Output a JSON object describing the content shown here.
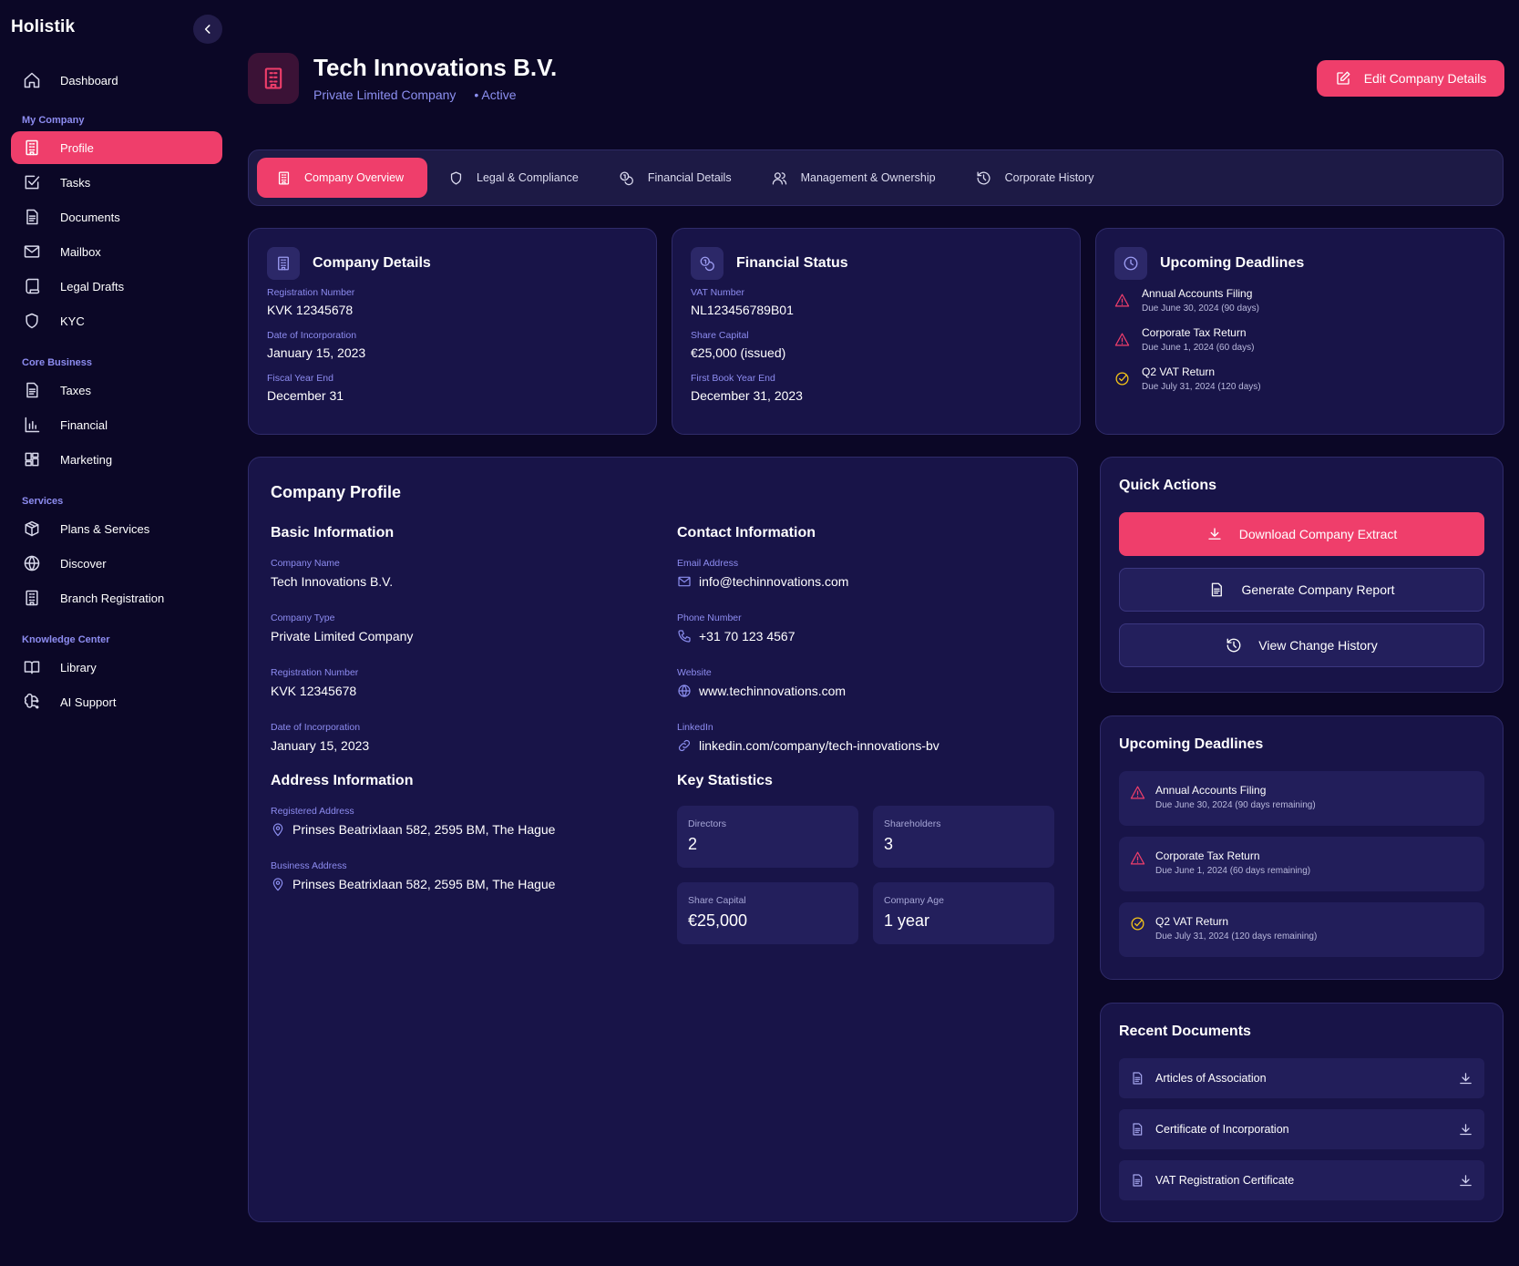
{
  "sidebar": {
    "brand": "Holistik",
    "sections": [
      {
        "title": "",
        "items": [
          {
            "label": "Dashboard",
            "icon": "home-icon"
          }
        ]
      },
      {
        "title": "My Company",
        "items": [
          {
            "label": "Profile",
            "icon": "building-icon",
            "active": true
          },
          {
            "label": "Tasks",
            "icon": "checkbox-icon"
          },
          {
            "label": "Documents",
            "icon": "document-icon"
          },
          {
            "label": "Mailbox",
            "icon": "mail-icon"
          },
          {
            "label": "Legal Drafts",
            "icon": "scroll-icon"
          },
          {
            "label": "KYC",
            "icon": "shield-icon"
          }
        ]
      },
      {
        "title": "Core Business",
        "items": [
          {
            "label": "Taxes",
            "icon": "document-icon"
          },
          {
            "label": "Financial",
            "icon": "bar-chart-icon"
          },
          {
            "label": "Marketing",
            "icon": "grid-icon"
          }
        ]
      },
      {
        "title": "Services",
        "items": [
          {
            "label": "Plans & Services",
            "icon": "package-icon"
          },
          {
            "label": "Discover",
            "icon": "globe-icon"
          },
          {
            "label": "Branch Registration",
            "icon": "building-icon"
          }
        ]
      },
      {
        "title": "Knowledge Center",
        "items": [
          {
            "label": "Library",
            "icon": "book-icon"
          },
          {
            "label": "AI Support",
            "icon": "brain-icon"
          }
        ]
      }
    ]
  },
  "header": {
    "company_name": "Tech Innovations B.V.",
    "company_type": "Private Limited Company",
    "status": "• Active",
    "edit_label": "Edit Company Details"
  },
  "tabs": [
    {
      "label": "Company Overview",
      "icon": "building-icon",
      "active": true
    },
    {
      "label": "Legal & Compliance",
      "icon": "shield-icon"
    },
    {
      "label": "Financial Details",
      "icon": "coins-icon"
    },
    {
      "label": "Management & Ownership",
      "icon": "users-icon"
    },
    {
      "label": "Corporate History",
      "icon": "history-icon"
    }
  ],
  "company_details": {
    "title": "Company Details",
    "fields": [
      {
        "label": "Registration Number",
        "value": "KVK 12345678"
      },
      {
        "label": "Date of Incorporation",
        "value": "January 15, 2023"
      },
      {
        "label": "Fiscal Year End",
        "value": "December 31"
      }
    ]
  },
  "financial_status": {
    "title": "Financial Status",
    "fields": [
      {
        "label": "VAT Number",
        "value": "NL123456789B01"
      },
      {
        "label": "Share Capital",
        "value": "€25,000 (issued)"
      },
      {
        "label": "First Book Year End",
        "value": "December 31, 2023"
      }
    ]
  },
  "upcoming_summary": {
    "title": "Upcoming Deadlines",
    "items": [
      {
        "title": "Annual Accounts Filing",
        "due": "Due  June 30, 2024  (90 days)",
        "status": "warning"
      },
      {
        "title": "Corporate Tax Return",
        "due": "Due  June 1, 2024  (60 days)",
        "status": "warning"
      },
      {
        "title": "Q2 VAT Return",
        "due": "Due  July 31, 2024  (120  days)",
        "status": "ok"
      }
    ]
  },
  "profile": {
    "title": "Company Profile",
    "basic": {
      "title": "Basic Information",
      "fields": [
        {
          "label": "Company Name",
          "value": "Tech Innovations B.V."
        },
        {
          "label": "Company Type",
          "value": "Private Limited Company"
        },
        {
          "label": "Registration Number",
          "value": "KVK 12345678"
        },
        {
          "label": "Date of Incorporation",
          "value": "January 15, 2023"
        }
      ]
    },
    "contact": {
      "title": "Contact Information",
      "fields": [
        {
          "label": "Email Address",
          "value": "info@techinnovations.com",
          "icon": "mail-icon"
        },
        {
          "label": "Phone Number",
          "value": "+31 70 123 4567",
          "icon": "phone-icon"
        },
        {
          "label": "Website",
          "value": "www.techinnovations.com",
          "icon": "globe-icon"
        },
        {
          "label": "LinkedIn",
          "value": "linkedin.com/company/tech-innovations-bv",
          "icon": "link-icon"
        }
      ]
    },
    "address": {
      "title": "Address Information",
      "fields": [
        {
          "label": "Registered Address",
          "value": "Prinses Beatrixlaan 582, 2595 BM, The Hague",
          "icon": "pin-icon"
        },
        {
          "label": "Business Address",
          "value": "Prinses Beatrixlaan 582, 2595 BM, The Hague",
          "icon": "pin-icon"
        }
      ]
    },
    "stats": {
      "title": "Key Statistics",
      "items": [
        {
          "label": "Directors",
          "value": "2"
        },
        {
          "label": "Shareholders",
          "value": "3"
        },
        {
          "label": "Share Capital",
          "value": "€25,000"
        },
        {
          "label": "Company Age",
          "value": "1 year"
        }
      ]
    }
  },
  "quick_actions": {
    "title": "Quick Actions",
    "buttons": [
      {
        "label": "Download Company Extract",
        "icon": "download-icon"
      },
      {
        "label": "Generate Company Report",
        "icon": "document-icon"
      },
      {
        "label": "View Change History",
        "icon": "history-icon"
      }
    ]
  },
  "deadlines": {
    "title": "Upcoming Deadlines",
    "items": [
      {
        "title": "Annual Accounts Filing",
        "due": "Due  June 30, 2024  (90 days remaining)",
        "status": "warning"
      },
      {
        "title": "Corporate Tax Return",
        "due": "Due  June 1, 2024  (60 days remaining)",
        "status": "warning"
      },
      {
        "title": "Q2 VAT Return",
        "due": "Due  July 31, 2024  (120  days remaining)",
        "status": "ok"
      }
    ]
  },
  "recent_docs": {
    "title": "Recent Documents",
    "items": [
      {
        "label": "Articles of Association"
      },
      {
        "label": "Certificate of Incorporation"
      },
      {
        "label": "VAT Registration Certificate"
      }
    ]
  },
  "colors": {
    "background": "#0b0726",
    "card": "#181448",
    "accent": "#ef3e6b",
    "muted_text": "#8d8cf0",
    "ok": "#f5c518"
  }
}
